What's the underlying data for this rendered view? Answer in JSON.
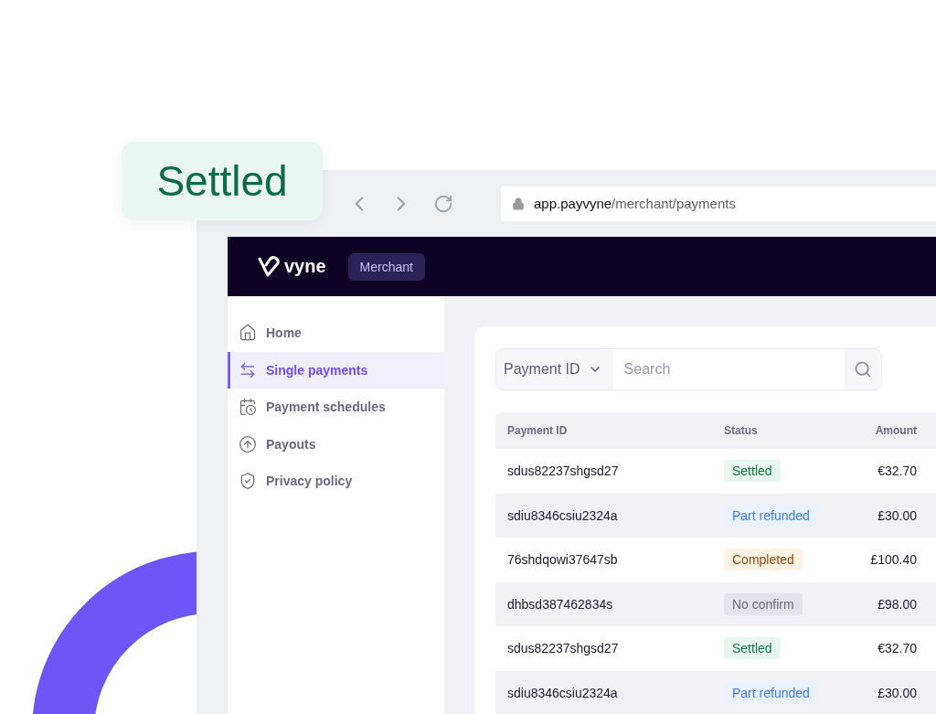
{
  "badge": {
    "text": "Settled"
  },
  "browser": {
    "url_host": "app.payvyne",
    "url_path": "/merchant/payments"
  },
  "header": {
    "logo": "vyne",
    "tag": "Merchant"
  },
  "sidebar": {
    "items": [
      {
        "label": "Home",
        "kind": "home",
        "selected": false
      },
      {
        "label": "Single payments",
        "kind": "transfer",
        "selected": true
      },
      {
        "label": "Payment schedules",
        "kind": "schedule",
        "selected": false
      },
      {
        "label": "Payouts",
        "kind": "payout",
        "selected": false
      },
      {
        "label": "Privacy policy",
        "kind": "privacy",
        "selected": false
      }
    ]
  },
  "search": {
    "filter": "Payment ID",
    "placeholder": "Search"
  },
  "table": {
    "columns": [
      "Payment ID",
      "Status",
      "Amount"
    ],
    "rows": [
      {
        "id": "sdus82237shgsd27",
        "status": "Settled",
        "kind": "settled",
        "amount": "€32.70"
      },
      {
        "id": "sdiu8346csiu2324a",
        "status": "Part refunded",
        "kind": "refunded",
        "amount": "£30.00"
      },
      {
        "id": "76shdqowi37647sb",
        "status": "Completed",
        "kind": "completed",
        "amount": "£100.40"
      },
      {
        "id": "dhbsd387462834s",
        "status": "No confirm",
        "kind": "unconfirmed",
        "amount": "£98.00"
      },
      {
        "id": "sdus82237shgsd27",
        "status": "Settled",
        "kind": "settled",
        "amount": "€32.70"
      },
      {
        "id": "sdiu8346csiu2324a",
        "status": "Part refunded",
        "kind": "refunded",
        "amount": "£30.00"
      }
    ]
  }
}
